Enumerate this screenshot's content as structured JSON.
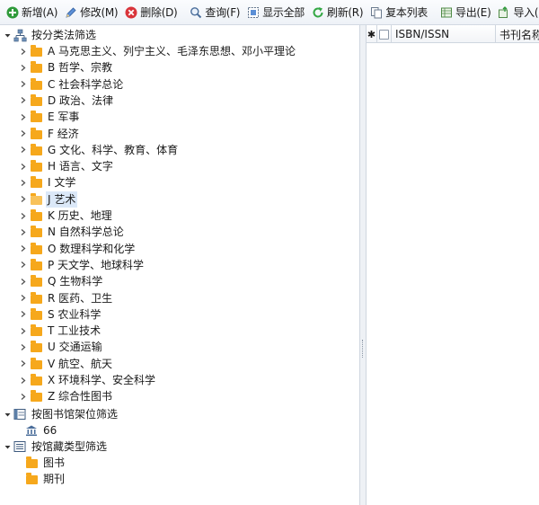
{
  "toolbar": {
    "add": "新增(A)",
    "edit": "修改(M)",
    "delete": "删除(D)",
    "query": "查询(F)",
    "show_all": "显示全部",
    "refresh": "刷新(R)",
    "copy_list": "复本列表",
    "export": "导出(E)",
    "import": "导入(I)"
  },
  "tree": {
    "classification": {
      "label": "按分类法筛选",
      "items": [
        {
          "label": "A 马克思主义、列宁主义、毛泽东思想、邓小平理论",
          "selected": false
        },
        {
          "label": "B 哲学、宗教",
          "selected": false
        },
        {
          "label": "C 社会科学总论",
          "selected": false
        },
        {
          "label": "D 政治、法律",
          "selected": false
        },
        {
          "label": "E 军事",
          "selected": false
        },
        {
          "label": "F 经济",
          "selected": false
        },
        {
          "label": "G 文化、科学、教育、体育",
          "selected": false
        },
        {
          "label": "H 语言、文字",
          "selected": false
        },
        {
          "label": "I 文学",
          "selected": false
        },
        {
          "label": "J 艺术",
          "selected": true
        },
        {
          "label": "K 历史、地理",
          "selected": false
        },
        {
          "label": "N 自然科学总论",
          "selected": false
        },
        {
          "label": "O 数理科学和化学",
          "selected": false
        },
        {
          "label": "P 天文学、地球科学",
          "selected": false
        },
        {
          "label": "Q 生物科学",
          "selected": false
        },
        {
          "label": "R 医药、卫生",
          "selected": false
        },
        {
          "label": "S 农业科学",
          "selected": false
        },
        {
          "label": "T 工业技术",
          "selected": false
        },
        {
          "label": "U 交通运输",
          "selected": false
        },
        {
          "label": "V 航空、航天",
          "selected": false
        },
        {
          "label": "X 环境科学、安全科学",
          "selected": false
        },
        {
          "label": "Z 综合性图书",
          "selected": false
        }
      ]
    },
    "shelf": {
      "label": "按图书馆架位筛选",
      "items": [
        {
          "label": "66"
        }
      ]
    },
    "collection_type": {
      "label": "按馆藏类型筛选",
      "items": [
        {
          "label": "图书"
        },
        {
          "label": "期刊"
        }
      ]
    }
  },
  "grid": {
    "row_marker": "✱",
    "columns": [
      "ISBN/ISSN",
      "书刊名称"
    ]
  },
  "colors": {
    "add_green": "#2e9a3a",
    "delete_red": "#d9343a",
    "refresh_green": "#35a845",
    "folder_orange": "#f6a81c",
    "selection_blue": "#dbe8f8"
  }
}
